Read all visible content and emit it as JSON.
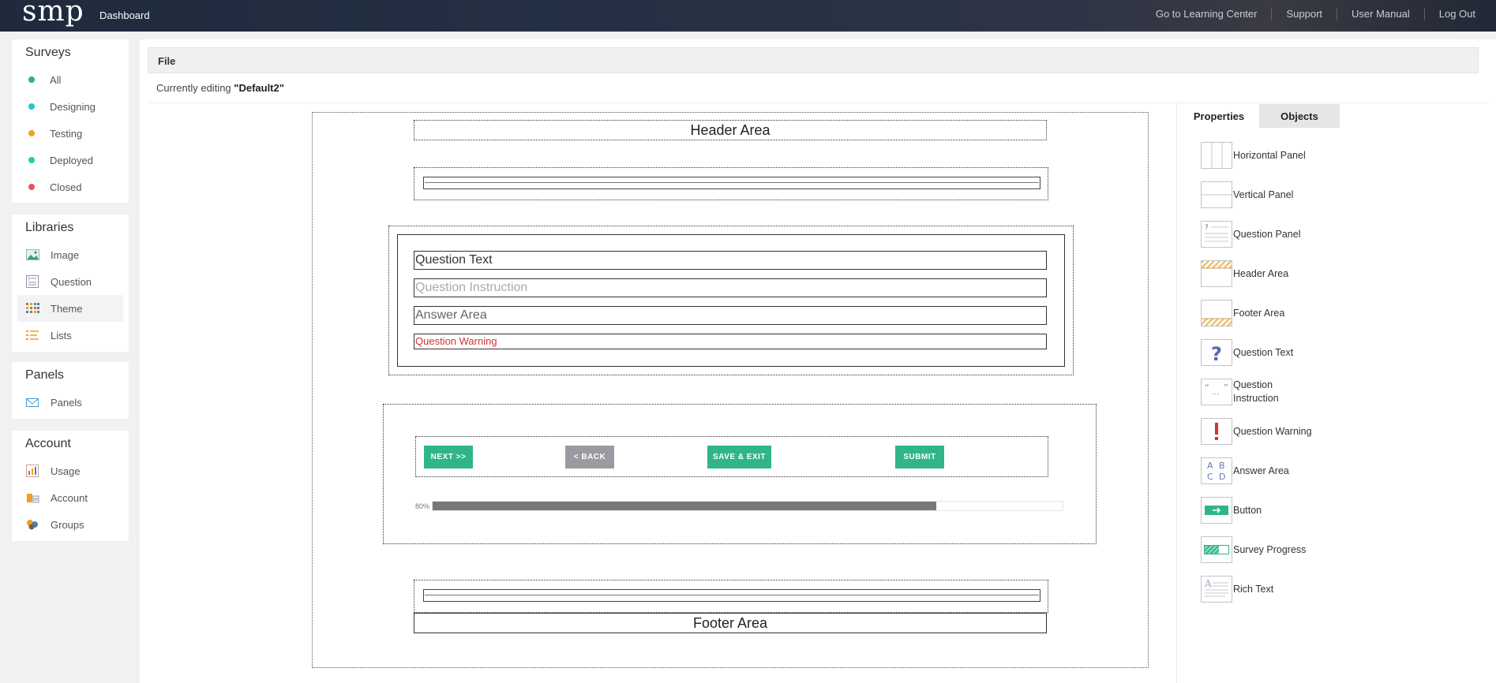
{
  "topbar": {
    "logo": "smp",
    "dashboard": "Dashboard",
    "links": [
      "Go to Learning Center",
      "Support",
      "User Manual",
      "Log Out"
    ]
  },
  "sidebar": {
    "surveys": {
      "title": "Surveys",
      "items": [
        {
          "label": "All",
          "color": "#2ab57d"
        },
        {
          "label": "Designing",
          "color": "#1ec6d6"
        },
        {
          "label": "Testing",
          "color": "#f0a020"
        },
        {
          "label": "Deployed",
          "color": "#1ccfb5"
        },
        {
          "label": "Closed",
          "color": "#e0585c"
        }
      ]
    },
    "libraries": {
      "title": "Libraries",
      "items": [
        {
          "label": "Image",
          "icon": "image-icon"
        },
        {
          "label": "Question",
          "icon": "question-list-icon"
        },
        {
          "label": "Theme",
          "icon": "theme-grid-icon"
        },
        {
          "label": "Lists",
          "icon": "lists-icon"
        }
      ]
    },
    "panels": {
      "title": "Panels",
      "items": [
        {
          "label": "Panels",
          "icon": "envelope-icon"
        }
      ]
    },
    "account": {
      "title": "Account",
      "items": [
        {
          "label": "Usage",
          "icon": "usage-chart-icon"
        },
        {
          "label": "Account",
          "icon": "account-icon"
        },
        {
          "label": "Groups",
          "icon": "groups-icon"
        }
      ]
    }
  },
  "main": {
    "file_menu": "File",
    "editing_prefix": "Currently editing ",
    "editing_name": "\"Default2\""
  },
  "canvas": {
    "header_label": "Header Area",
    "footer_label": "Footer Area",
    "question_text": "Question Text",
    "question_instruction": "Question Instruction",
    "answer_area": "Answer Area",
    "question_warning": "Question Warning",
    "buttons": {
      "next": "NEXT >>",
      "back": "< BACK",
      "save_exit": "SAVE & EXIT",
      "submit": "SUBMIT"
    },
    "progress": {
      "label": "80%",
      "value": 0.8
    }
  },
  "right_panel": {
    "tabs": [
      "Properties",
      "Objects"
    ],
    "objects": [
      {
        "label": "Horizontal Panel",
        "icon": "horizontal-panel-icon"
      },
      {
        "label": "Vertical Panel",
        "icon": "vertical-panel-icon"
      },
      {
        "label": "Question Panel",
        "icon": "question-panel-icon"
      },
      {
        "label": "Header Area",
        "icon": "header-area-icon"
      },
      {
        "label": "Footer Area",
        "icon": "footer-area-icon"
      },
      {
        "label": "Question Text",
        "icon": "question-mark-icon"
      },
      {
        "label": "Question Instruction",
        "icon": "quote-icon"
      },
      {
        "label": "Question Warning",
        "icon": "exclamation-icon"
      },
      {
        "label": "Answer Area",
        "icon": "abcd-icon"
      },
      {
        "label": "Button",
        "icon": "button-arrow-icon"
      },
      {
        "label": "Survey Progress",
        "icon": "progress-icon"
      },
      {
        "label": "Rich Text",
        "icon": "rich-text-icon"
      }
    ]
  }
}
